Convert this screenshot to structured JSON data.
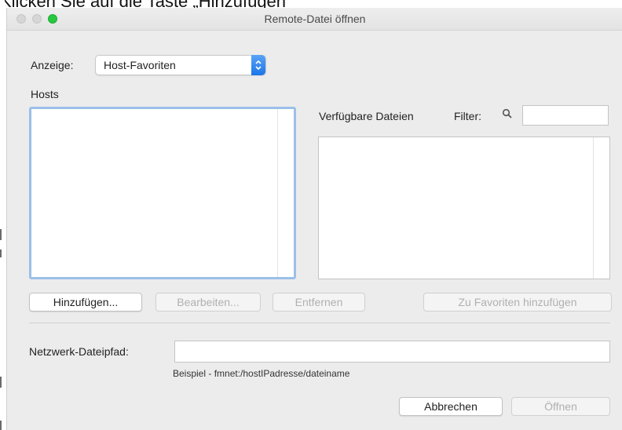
{
  "caption": "Klicken Sie auf die Taste „Hinzufügen“",
  "window": {
    "title": "Remote-Datei öffnen"
  },
  "display": {
    "label": "Anzeige:",
    "selected": "Host-Favoriten"
  },
  "hosts": {
    "label": "Hosts",
    "items": []
  },
  "files": {
    "label": "Verfügbare Dateien",
    "filter_label": "Filter:",
    "filter_value": "",
    "items": []
  },
  "buttons": {
    "add": "Hinzufügen...",
    "edit": "Bearbeiten...",
    "remove": "Entfernen",
    "add_favorite": "Zu Favoriten hinzufügen",
    "cancel": "Abbrechen",
    "open": "Öffnen"
  },
  "network_path": {
    "label": "Netzwerk-Dateipfad:",
    "value": "",
    "example": "Beispiel - fmnet:/hostIPadresse/dateiname"
  },
  "colors": {
    "accent": "#1b76e8",
    "focus_ring": "#9bbfe8",
    "close_light": "#d6d6d6",
    "zoom_light": "#28c840"
  }
}
